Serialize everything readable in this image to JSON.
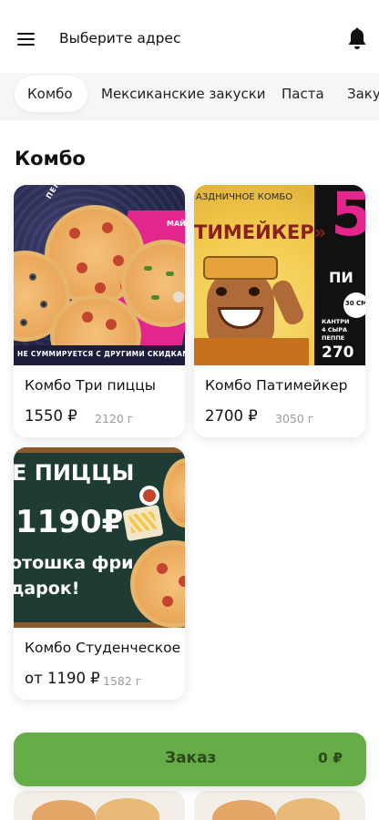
{
  "header": {
    "address_prompt": "Выберите адрес",
    "menu_icon": "hamburger-menu-icon",
    "notifications_icon": "bell-icon"
  },
  "categories": {
    "items": [
      {
        "label": "Комбо",
        "active": true
      },
      {
        "label": "Мексиканские закуски",
        "active": false
      },
      {
        "label": "Паста",
        "active": false
      },
      {
        "label": "Закуски",
        "active": false
      }
    ]
  },
  "section": {
    "title": "Комбо"
  },
  "products": [
    {
      "name": "Комбо Три пиццы",
      "price": "1550 ₽",
      "weight": "2120 г",
      "image_text": {
        "top_label": "ПЕППЕРОНИ",
        "side_label": "МАЙ",
        "bottom_banner": "НЕ СУММИРУЕТСЯ С ДРУГИМИ СКИДКАМИ"
      }
    },
    {
      "name": "Комбо Патимейкер",
      "price": "2700 ₽",
      "weight": "3050 г",
      "image_text": {
        "headline_top": "АЗДНИЧНОЕ КОМБО",
        "headline": "ТИМЕЙКЕР»",
        "big_digit": "5",
        "side_word": "ПИ",
        "list": [
          "КАНТРИ",
          "4 СЫРА",
          "ПЕППЕ"
        ],
        "badge": "30 СМ",
        "price_tag": "270"
      }
    },
    {
      "name": "Комбо Студенческое",
      "price": "от 1190 ₽",
      "weight": "1582 г",
      "image_text": {
        "line1": "Е ПИЦЦЫ",
        "line2": "1190₽",
        "line3": "отошка фри",
        "line4": "дарок!"
      }
    }
  ],
  "order_bar": {
    "label": "Заказ",
    "total": "0 ₽"
  },
  "colors": {
    "accent_green": "#66ad47",
    "category_bg": "#f6f6f6",
    "weight_grey": "#9a9a9a"
  }
}
